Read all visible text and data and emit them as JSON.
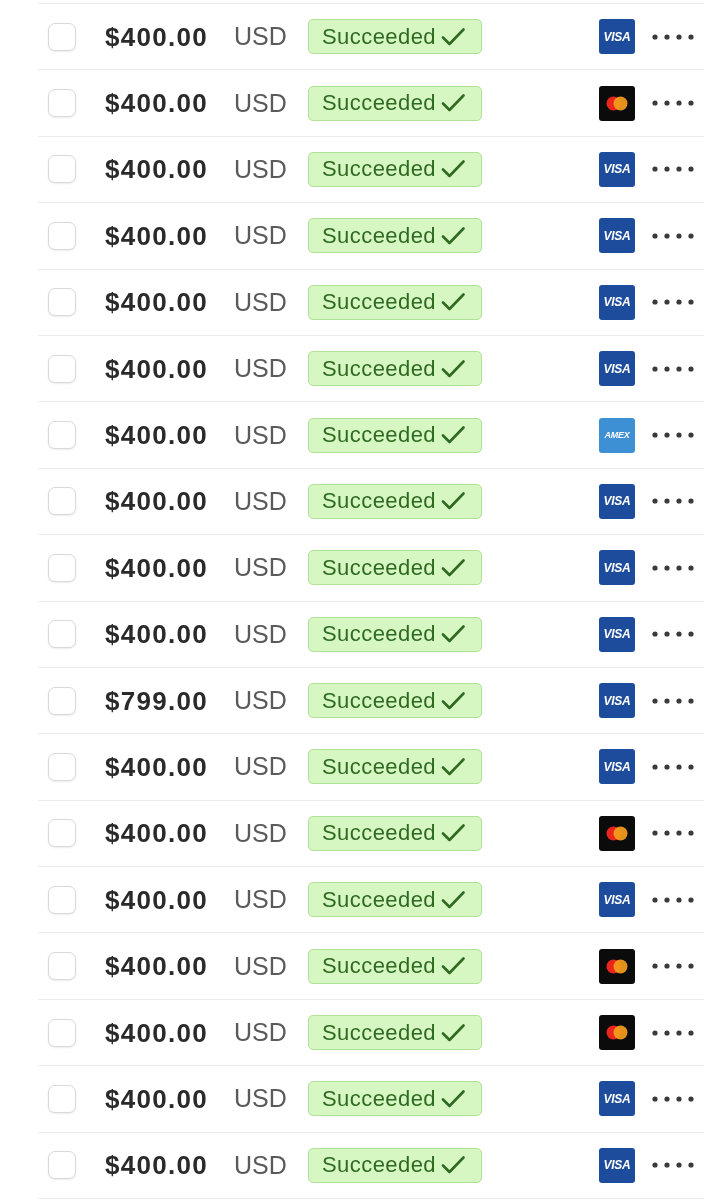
{
  "payments": [
    {
      "checked": false,
      "amount": "$400.00",
      "currency": "USD",
      "status": "Succeeded",
      "card": {
        "kind": "visa",
        "label": "VISA"
      }
    },
    {
      "checked": false,
      "amount": "$400.00",
      "currency": "USD",
      "status": "Succeeded",
      "card": {
        "kind": "mastercard"
      }
    },
    {
      "checked": false,
      "amount": "$400.00",
      "currency": "USD",
      "status": "Succeeded",
      "card": {
        "kind": "visa",
        "label": "VISA"
      }
    },
    {
      "checked": false,
      "amount": "$400.00",
      "currency": "USD",
      "status": "Succeeded",
      "card": {
        "kind": "visa",
        "label": "VISA"
      }
    },
    {
      "checked": false,
      "amount": "$400.00",
      "currency": "USD",
      "status": "Succeeded",
      "card": {
        "kind": "visa",
        "label": "VISA"
      }
    },
    {
      "checked": false,
      "amount": "$400.00",
      "currency": "USD",
      "status": "Succeeded",
      "card": {
        "kind": "visa",
        "label": "VISA"
      }
    },
    {
      "checked": false,
      "amount": "$400.00",
      "currency": "USD",
      "status": "Succeeded",
      "card": {
        "kind": "amex",
        "label": "AMEX"
      }
    },
    {
      "checked": false,
      "amount": "$400.00",
      "currency": "USD",
      "status": "Succeeded",
      "card": {
        "kind": "visa",
        "label": "VISA"
      }
    },
    {
      "checked": false,
      "amount": "$400.00",
      "currency": "USD",
      "status": "Succeeded",
      "card": {
        "kind": "visa",
        "label": "VISA"
      }
    },
    {
      "checked": false,
      "amount": "$400.00",
      "currency": "USD",
      "status": "Succeeded",
      "card": {
        "kind": "visa",
        "label": "VISA"
      }
    },
    {
      "checked": false,
      "amount": "$799.00",
      "currency": "USD",
      "status": "Succeeded",
      "card": {
        "kind": "visa",
        "label": "VISA"
      }
    },
    {
      "checked": false,
      "amount": "$400.00",
      "currency": "USD",
      "status": "Succeeded",
      "card": {
        "kind": "visa",
        "label": "VISA"
      }
    },
    {
      "checked": false,
      "amount": "$400.00",
      "currency": "USD",
      "status": "Succeeded",
      "card": {
        "kind": "mastercard"
      }
    },
    {
      "checked": false,
      "amount": "$400.00",
      "currency": "USD",
      "status": "Succeeded",
      "card": {
        "kind": "visa",
        "label": "VISA"
      }
    },
    {
      "checked": false,
      "amount": "$400.00",
      "currency": "USD",
      "status": "Succeeded",
      "card": {
        "kind": "mastercard"
      }
    },
    {
      "checked": false,
      "amount": "$400.00",
      "currency": "USD",
      "status": "Succeeded",
      "card": {
        "kind": "mastercard"
      }
    },
    {
      "checked": false,
      "amount": "$400.00",
      "currency": "USD",
      "status": "Succeeded",
      "card": {
        "kind": "visa",
        "label": "VISA"
      }
    },
    {
      "checked": false,
      "amount": "$400.00",
      "currency": "USD",
      "status": "Succeeded",
      "card": {
        "kind": "visa",
        "label": "VISA"
      }
    }
  ]
}
